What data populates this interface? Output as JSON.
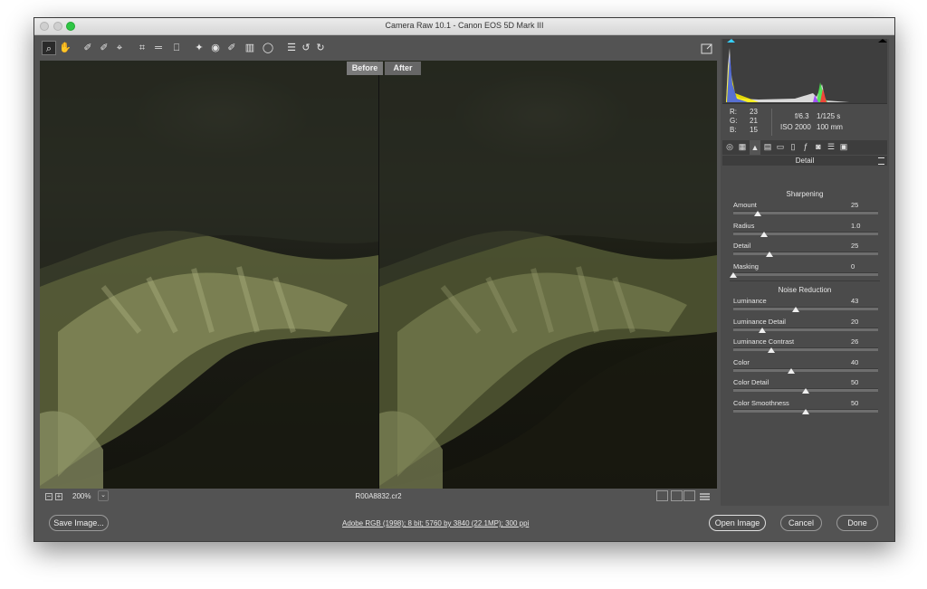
{
  "window": {
    "title": "Camera Raw 10.1  -  Canon EOS 5D Mark III"
  },
  "toolbar": {
    "tools": [
      {
        "name": "zoom-tool-icon",
        "glyph": "⌕",
        "active": true
      },
      {
        "name": "hand-tool-icon",
        "glyph": "✋"
      },
      {
        "name": "white-balance-tool-icon",
        "glyph": "✐"
      },
      {
        "name": "color-sampler-tool-icon",
        "glyph": "✐"
      },
      {
        "name": "targeted-adjustment-tool-icon",
        "glyph": "⌖"
      },
      {
        "name": "crop-tool-icon",
        "glyph": "⌗"
      },
      {
        "name": "straighten-tool-icon",
        "glyph": "═"
      },
      {
        "name": "transform-tool-icon",
        "glyph": "⎕"
      },
      {
        "name": "spot-removal-tool-icon",
        "glyph": "✦"
      },
      {
        "name": "red-eye-tool-icon",
        "glyph": "◉"
      },
      {
        "name": "adjustment-brush-icon",
        "glyph": "✐"
      },
      {
        "name": "graduated-filter-icon",
        "glyph": "▥"
      },
      {
        "name": "radial-filter-icon",
        "glyph": "◯"
      },
      {
        "name": "preferences-icon",
        "glyph": "☰"
      },
      {
        "name": "rotate-ccw-icon",
        "glyph": "↺"
      },
      {
        "name": "rotate-cw-icon",
        "glyph": "↻"
      }
    ]
  },
  "preview": {
    "before_label": "Before",
    "after_label": "After"
  },
  "statusbar": {
    "zoom": "200%",
    "filename": "R00A8832.cr2"
  },
  "bottom": {
    "save_label": "Save Image...",
    "workflow_info": "Adobe RGB (1998); 8 bit; 5760 by 3840 (22.1MP); 300 ppi",
    "open_label": "Open Image",
    "cancel_label": "Cancel",
    "done_label": "Done"
  },
  "exif": {
    "r_label": "R:",
    "r_value": "23",
    "g_label": "G:",
    "g_value": "21",
    "b_label": "B:",
    "b_value": "15",
    "aperture": "f/6.3",
    "shutter": "1/125 s",
    "iso": "ISO 2000",
    "focal": "100 mm"
  },
  "panel": {
    "title": "Detail",
    "sharpening": {
      "heading": "Sharpening",
      "sliders": [
        {
          "label": "Amount",
          "value": "25",
          "fraction": 0.17
        },
        {
          "label": "Radius",
          "value": "1.0",
          "fraction": 0.21
        },
        {
          "label": "Detail",
          "value": "25",
          "fraction": 0.25
        },
        {
          "label": "Masking",
          "value": "0",
          "fraction": 0.0
        }
      ]
    },
    "noise": {
      "heading": "Noise Reduction",
      "sliders": [
        {
          "label": "Luminance",
          "value": "43",
          "fraction": 0.43
        },
        {
          "label": "Luminance Detail",
          "value": "20",
          "fraction": 0.2
        },
        {
          "label": "Luminance Contrast",
          "value": "26",
          "fraction": 0.26
        },
        {
          "label": "Color",
          "value": "40",
          "fraction": 0.4
        },
        {
          "label": "Color Detail",
          "value": "50",
          "fraction": 0.5
        },
        {
          "label": "Color Smoothness",
          "value": "50",
          "fraction": 0.5
        }
      ]
    }
  }
}
